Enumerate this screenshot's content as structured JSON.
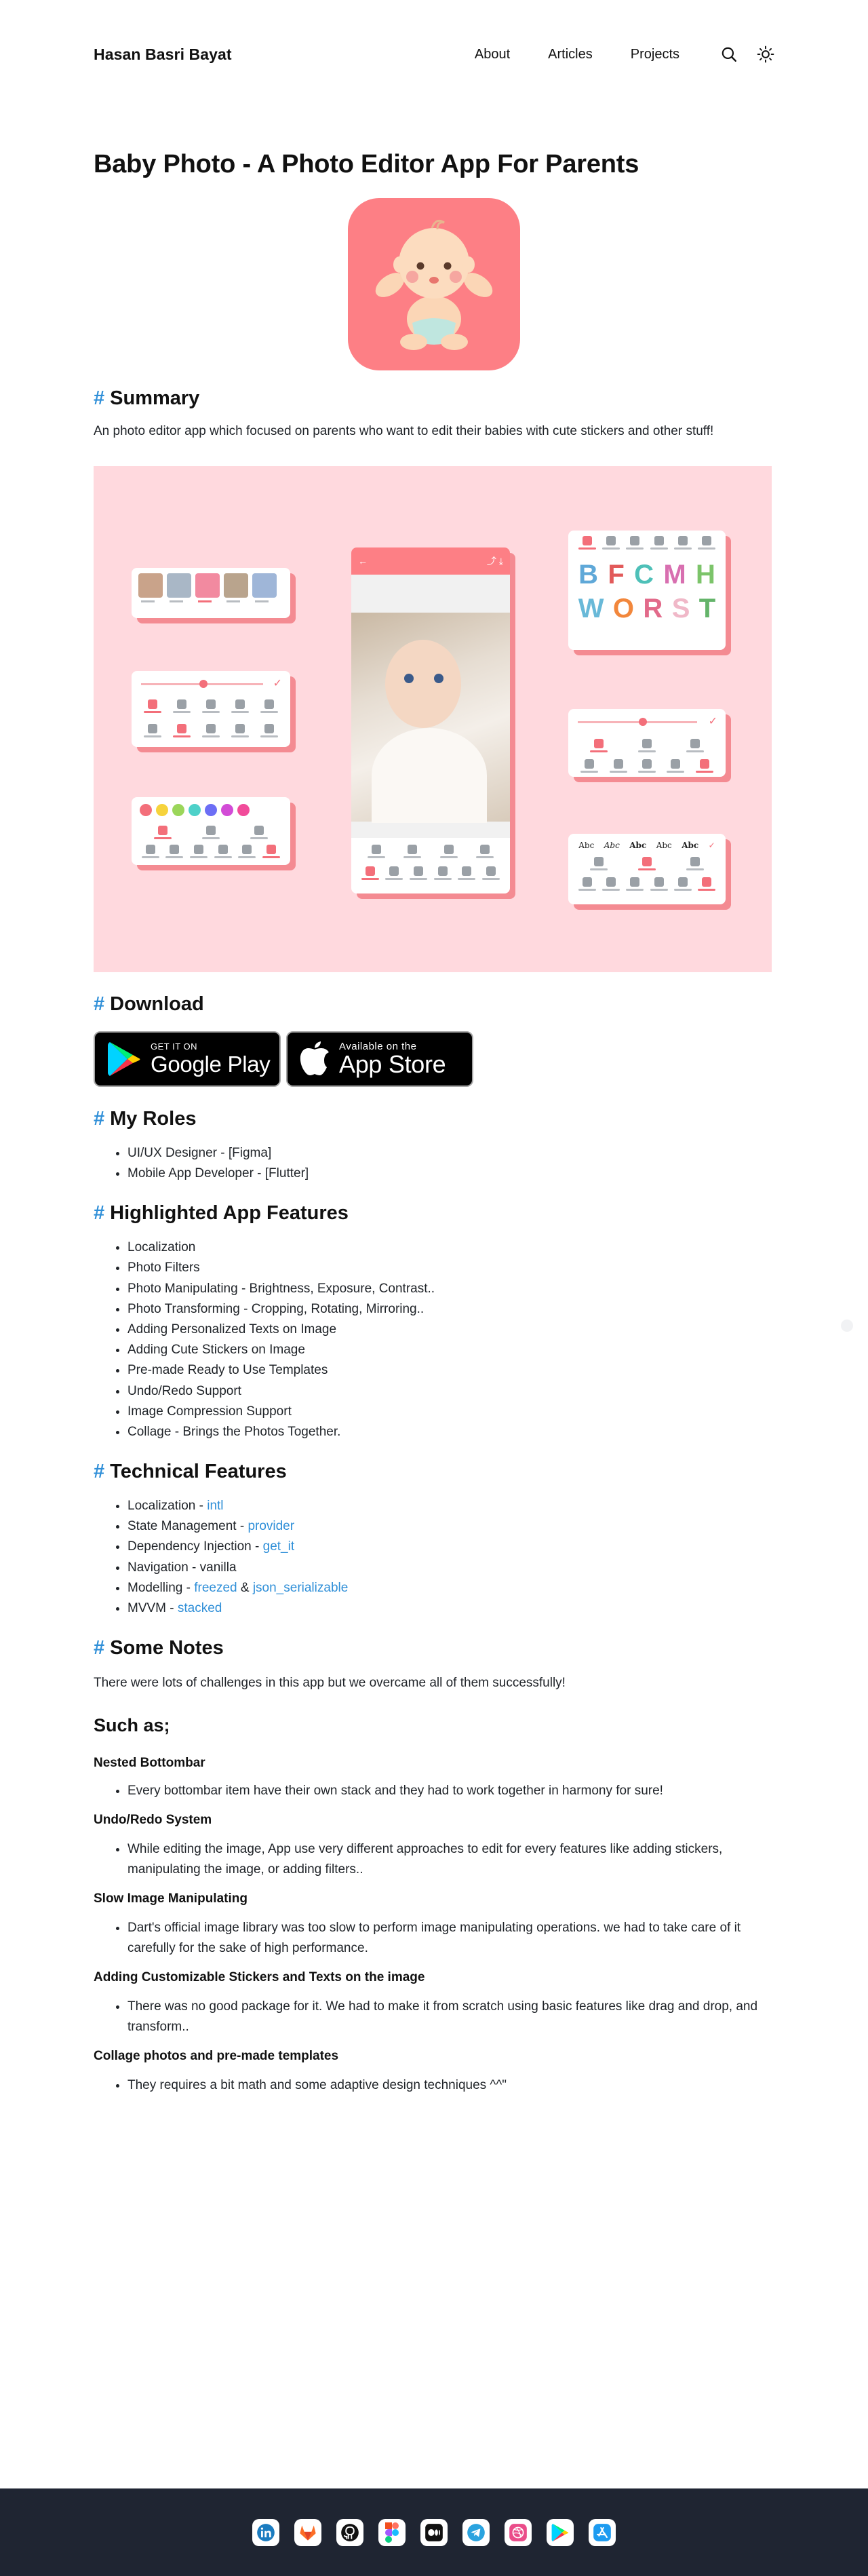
{
  "header": {
    "brand": "Hasan Basri Bayat",
    "nav": [
      "About",
      "Articles",
      "Projects"
    ],
    "icons": [
      "search-icon",
      "sun-icon"
    ]
  },
  "page": {
    "title": "Baby Photo - A Photo Editor App For Parents",
    "app_icon_color": "#fd7f85"
  },
  "summary": {
    "heading": "Summary",
    "text": "An photo editor app which focused on parents who want to edit their babies with cute stickers and other stuff!"
  },
  "showcase": {
    "background": "#ffd9de",
    "sticker_letters": [
      "B",
      "F",
      "C",
      "M",
      "H",
      "W",
      "O",
      "R",
      "S",
      "T"
    ]
  },
  "download": {
    "heading": "Download",
    "google_small": "GET IT ON",
    "google_big": "Google Play",
    "apple_small": "Available on the",
    "apple_big": "App Store"
  },
  "roles": {
    "heading": "My Roles",
    "items": [
      "UI/UX Designer - [Figma]",
      "Mobile App Developer - [Flutter]"
    ]
  },
  "features": {
    "heading": "Highlighted App Features",
    "items": [
      "Localization",
      "Photo Filters",
      "Photo Manipulating - Brightness, Exposure, Contrast..",
      "Photo Transforming - Cropping, Rotating, Mirroring..",
      "Adding Personalized Texts on Image",
      "Adding Cute Stickers on Image",
      "Pre-made Ready to Use Templates",
      "Undo/Redo Support",
      "Image Compression Support",
      "Collage - Brings the Photos Together."
    ]
  },
  "tech": {
    "heading": "Technical Features",
    "items": [
      {
        "label": "Localization - ",
        "link": "intl"
      },
      {
        "label": "State Management - ",
        "link": "provider"
      },
      {
        "label": "Dependency Injection - ",
        "link": "get_it"
      },
      {
        "label": "Navigation - vanilla"
      },
      {
        "label": "Modelling - ",
        "link": "freezed",
        "joiner": " & ",
        "link2": "json_serializable"
      },
      {
        "label": "MVVM - ",
        "link": "stacked"
      }
    ]
  },
  "notes": {
    "heading": "Some Notes",
    "intro": "There were lots of challenges in this app but we overcame all of them successfully!",
    "subheading": "Such as;",
    "items": [
      {
        "title": "Nested Bottombar",
        "text": "Every bottombar item have their own stack and they had to work together in harmony for sure!"
      },
      {
        "title": "Undo/Redo System",
        "text": "While editing the image, App use very different approaches to edit for every features like adding stickers, manipulating the image, or adding filters.."
      },
      {
        "title": "Slow Image Manipulating",
        "text": "Dart's official image library was too slow to perform image manipulating operations. we had to take care of it carefully for the sake of high performance."
      },
      {
        "title": "Adding Customizable Stickers and Texts on the image",
        "text": "There was no good package for it. We had to make it from scratch using basic features like drag and drop, and transform.."
      },
      {
        "title": "Collage photos and pre-made templates",
        "text": "They requires a bit math and some adaptive design techniques ^^\""
      }
    ]
  },
  "footer": {
    "icons": [
      "linkedin-icon",
      "gitlab-icon",
      "github-icon",
      "figma-icon",
      "medium-icon",
      "telegram-icon",
      "dribbble-icon",
      "google-play-icon",
      "app-store-icon"
    ]
  },
  "colors": {
    "accent": "#2f8fd8",
    "link": "#2f8fd8",
    "footer": "#1f2532",
    "pink": "#f36f7a"
  }
}
